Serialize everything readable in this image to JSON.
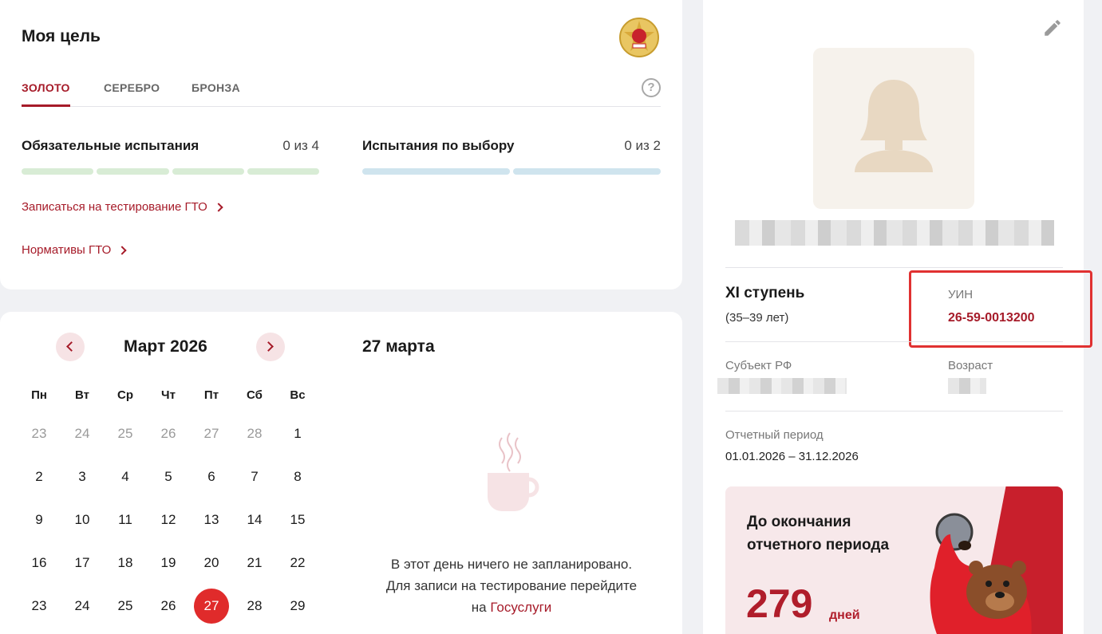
{
  "goal": {
    "title": "Моя цель",
    "tabs": [
      {
        "label": "ЗОЛОТО",
        "active": true
      },
      {
        "label": "СЕРЕБРО",
        "active": false
      },
      {
        "label": "БРОНЗА",
        "active": false
      }
    ],
    "help_icon": "question-circle-icon",
    "mandatory": {
      "label": "Обязательные испытания",
      "count": "0 из 4",
      "bars": 4
    },
    "optional": {
      "label": "Испытания по выбору",
      "count": "0 из 2",
      "bars": 2
    },
    "link_register": "Записаться на тестирование ГТО",
    "link_norms": "Нормативы ГТО"
  },
  "calendar": {
    "month": "Март 2026",
    "selected_day_title": "27 марта",
    "weekdays": [
      "Пн",
      "Вт",
      "Ср",
      "Чт",
      "Пт",
      "Сб",
      "Вс"
    ],
    "weeks": [
      [
        {
          "d": "23",
          "m": true
        },
        {
          "d": "24",
          "m": true
        },
        {
          "d": "25",
          "m": true
        },
        {
          "d": "26",
          "m": true
        },
        {
          "d": "27",
          "m": true
        },
        {
          "d": "28",
          "m": true
        },
        {
          "d": "1"
        }
      ],
      [
        {
          "d": "2"
        },
        {
          "d": "3"
        },
        {
          "d": "4"
        },
        {
          "d": "5"
        },
        {
          "d": "6"
        },
        {
          "d": "7"
        },
        {
          "d": "8"
        }
      ],
      [
        {
          "d": "9"
        },
        {
          "d": "10"
        },
        {
          "d": "11"
        },
        {
          "d": "12"
        },
        {
          "d": "13"
        },
        {
          "d": "14"
        },
        {
          "d": "15"
        }
      ],
      [
        {
          "d": "16"
        },
        {
          "d": "17"
        },
        {
          "d": "18"
        },
        {
          "d": "19"
        },
        {
          "d": "20"
        },
        {
          "d": "21"
        },
        {
          "d": "22"
        }
      ],
      [
        {
          "d": "23"
        },
        {
          "d": "24"
        },
        {
          "d": "25"
        },
        {
          "d": "26"
        },
        {
          "d": "27",
          "sel": true
        },
        {
          "d": "28"
        },
        {
          "d": "29"
        }
      ]
    ],
    "empty_line1": "В этот день ничего не запланировано.",
    "empty_line2": "Для записи на тестирование перейдите",
    "empty_line3_prefix": "на",
    "empty_link": "Госуслуги"
  },
  "profile": {
    "stage": "XI ступень",
    "stage_age": "(35–39 лет)",
    "uin_label": "УИН",
    "uin_value": "26-59-0013200",
    "region_label": "Субъект РФ",
    "age_label": "Возраст",
    "period_label": "Отчетный период",
    "period_value": "01.01.2026 – 31.12.2026",
    "promo_title_1": "До окончания",
    "promo_title_2": "отчетного периода",
    "promo_days": "279",
    "promo_unit": "дней"
  },
  "colors": {
    "accent": "#a61b29",
    "selected": "#e02b2b",
    "highlight_box": "#e03131"
  }
}
